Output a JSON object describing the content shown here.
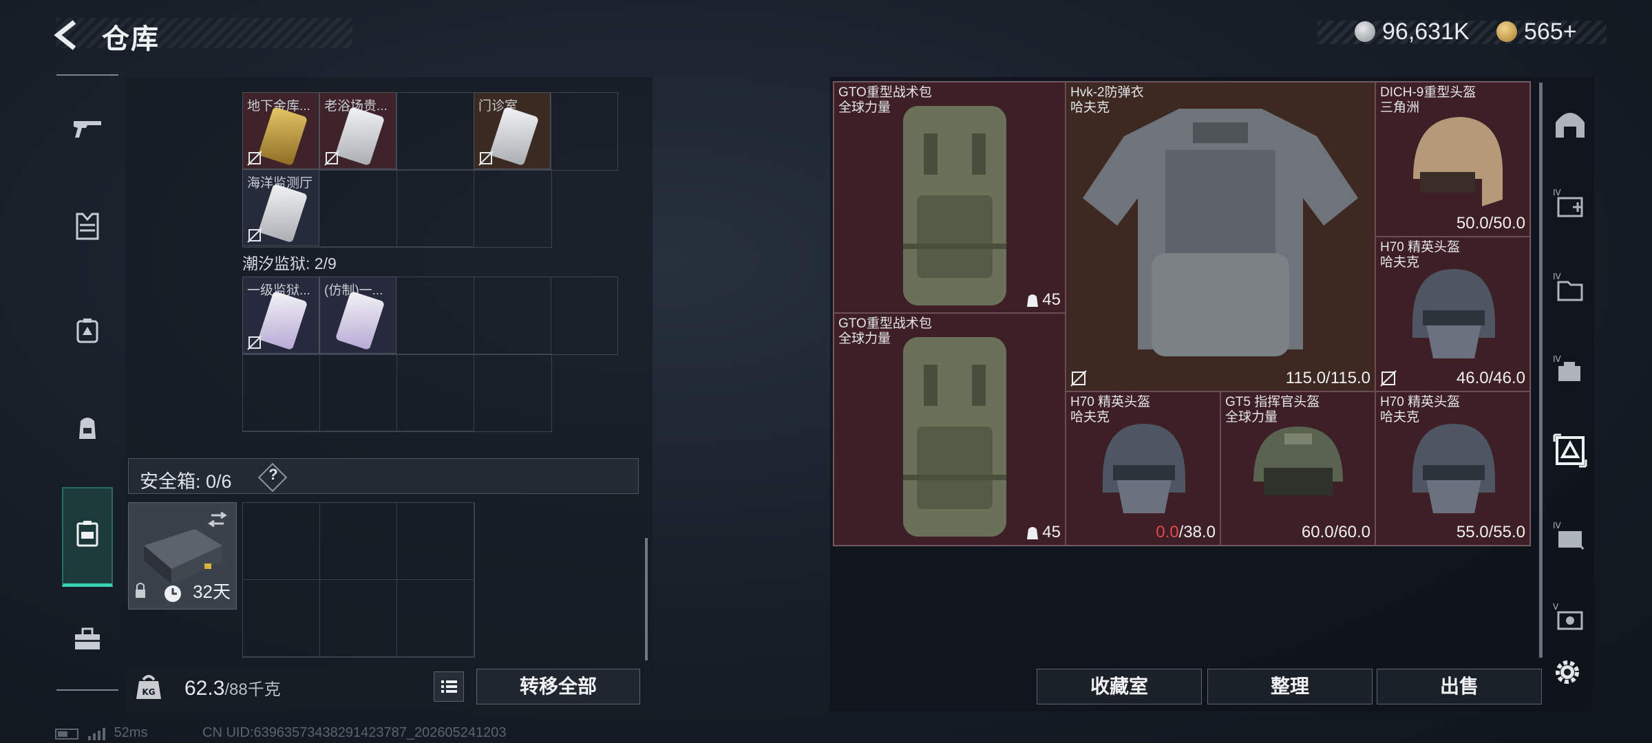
{
  "header": {
    "title": "仓库"
  },
  "currency": [
    {
      "icon": "silver-coin-icon",
      "value": "96,631K",
      "color": "#b9bec4"
    },
    {
      "icon": "gold-coin-icon",
      "value": "565+",
      "color": "#d9b15a"
    }
  ],
  "left_nav": [
    {
      "icon": "gun-icon"
    },
    {
      "icon": "armor-vest-icon"
    },
    {
      "icon": "chest-rig-icon"
    },
    {
      "icon": "backpack-icon"
    },
    {
      "icon": "safe-case-icon",
      "active": true
    },
    {
      "icon": "toolbox-icon"
    }
  ],
  "storage": {
    "group1_items": [
      {
        "label": "地下金库..."
      },
      {
        "label": "老浴场贵..."
      },
      {
        "label": "门诊室"
      },
      {
        "label": "海洋监测厅"
      }
    ],
    "group2_title": "潮汐监狱: 2/9",
    "group2_items": [
      {
        "label": "一级监狱..."
      },
      {
        "label": "(仿制)一..."
      }
    ]
  },
  "safe_case": {
    "title": "安全箱: 0/6",
    "help": "?",
    "days": "32天"
  },
  "bottom": {
    "weight": "62.3",
    "weight_max": "/88千克",
    "transfer_label": "转移全部"
  },
  "status": {
    "ping": "52ms",
    "uid": "CN UID:6396357343829142378​7_202605241203"
  },
  "gear": [
    {
      "name": "GTO重型战术包",
      "sub": "全球力量",
      "capacity": "45"
    },
    {
      "name": "Hvk-2防弹衣",
      "sub": "哈夫克",
      "durability": "115.0/115.0"
    },
    {
      "name": "DICH-9重型头盔",
      "sub": "三角洲",
      "durability": "50.0/50.0"
    },
    {
      "name": "H70 精英头盔",
      "sub": "哈夫克",
      "durability": "46.0/46.0"
    },
    {
      "name": "GTO重型战术包",
      "sub": "全球力量",
      "capacity": "45"
    },
    {
      "name": "H70 精英头盔",
      "sub": "哈夫克",
      "durability_current": "0.0",
      "durability_max": "/38.0"
    },
    {
      "name": "GT5 指挥官头盔",
      "sub": "全球力量",
      "durability": "60.0/60.0"
    },
    {
      "name": "H70 精英头盔",
      "sub": "哈夫克",
      "durability": "55.0/55.0"
    }
  ],
  "right_nav": [
    {
      "icon": "vault-arch-icon"
    },
    {
      "icon": "medic-kit-tier4-icon"
    },
    {
      "icon": "folder-tier4-icon"
    },
    {
      "icon": "armor-tier4-icon"
    },
    {
      "icon": "collection-tier4-icon",
      "active": true
    },
    {
      "icon": "rig-tier4-icon"
    },
    {
      "icon": "case-tier5-icon"
    }
  ],
  "actions": {
    "collection": "收藏室",
    "sort": "整理",
    "sell": "出售"
  },
  "colors": {
    "accent_teal": "#37d3b2",
    "item_red": "#3f1f26",
    "warning_red": "#e04a4a"
  }
}
